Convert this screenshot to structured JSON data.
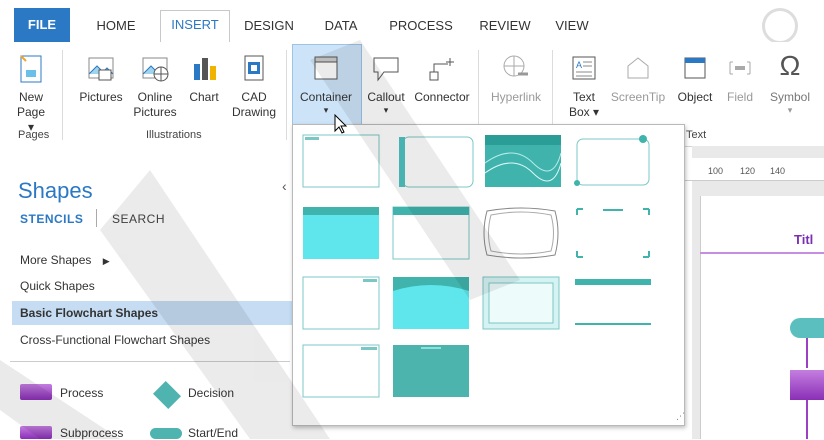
{
  "tabs": {
    "file": "FILE",
    "home": "HOME",
    "insert": "INSERT",
    "design": "DESIGN",
    "data": "DATA",
    "process": "PROCESS",
    "review": "REVIEW",
    "view": "VIEW"
  },
  "ribbon": {
    "new_page": "New Page ▾",
    "pictures": "Pictures",
    "online_pictures": "Online Pictures",
    "chart": "Chart",
    "cad_drawing": "CAD Drawing",
    "container": "Container",
    "callout": "Callout",
    "connector": "Connector",
    "hyperlink": "Hyperlink",
    "text_box": "Text Box ▾",
    "screentip": "ScreenTip",
    "object": "Object",
    "field": "Field",
    "symbol": "Symbol",
    "group_pages": "Pages",
    "group_illustrations": "Illustrations",
    "group_text": "Text"
  },
  "shapes_pane": {
    "title": "Shapes",
    "stencils": "STENCILS",
    "search": "SEARCH",
    "more_shapes": "More Shapes",
    "quick_shapes": "Quick Shapes",
    "basic_flowchart": "Basic Flowchart Shapes",
    "cross_functional": "Cross-Functional Flowchart Shapes",
    "stencil_items": [
      "Process",
      "Decision",
      "Subprocess",
      "Start/End"
    ]
  },
  "ruler": {
    "ticks": [
      "100",
      "120",
      "140"
    ]
  },
  "canvas": {
    "title_text": "Titl"
  },
  "colors": {
    "accent": "#2b78c5",
    "teal": "#4fc3c0",
    "purple": "#9b3fc4"
  }
}
